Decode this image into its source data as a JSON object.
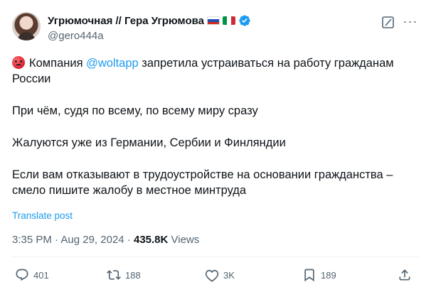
{
  "author": {
    "display_name": "Угрюмочная // Гера Угрюмова",
    "handle": "@gero444a",
    "flags": [
      "russia-flag",
      "italy-flag"
    ],
    "verified": true
  },
  "colors": {
    "text": "#0f1419",
    "muted": "#536471",
    "link": "#1d9bf0",
    "verified_badge": "#1d9bf0"
  },
  "tweet": {
    "line1_before": "Компания ",
    "mention": "@woltapp",
    "line1_after": " запретила устраиваться на работу гражданам России",
    "para2": "При чём, судя по всему, по всему миру сразу",
    "para3": "Жалуются уже из Германии, Сербии и Финляндии",
    "para4": "Если вам отказывают в трудоустройстве на основании гражданства – смело пишите жалобу в местное минтруда"
  },
  "translate_label": "Translate post",
  "meta": {
    "time": "3:35 PM",
    "sep": " · ",
    "date": "Aug 29, 2024",
    "sep2": " · ",
    "views_count": "435.8K",
    "views_label": " Views"
  },
  "actions": {
    "replies": "401",
    "reposts": "188",
    "likes": "3K",
    "bookmarks": "189"
  }
}
